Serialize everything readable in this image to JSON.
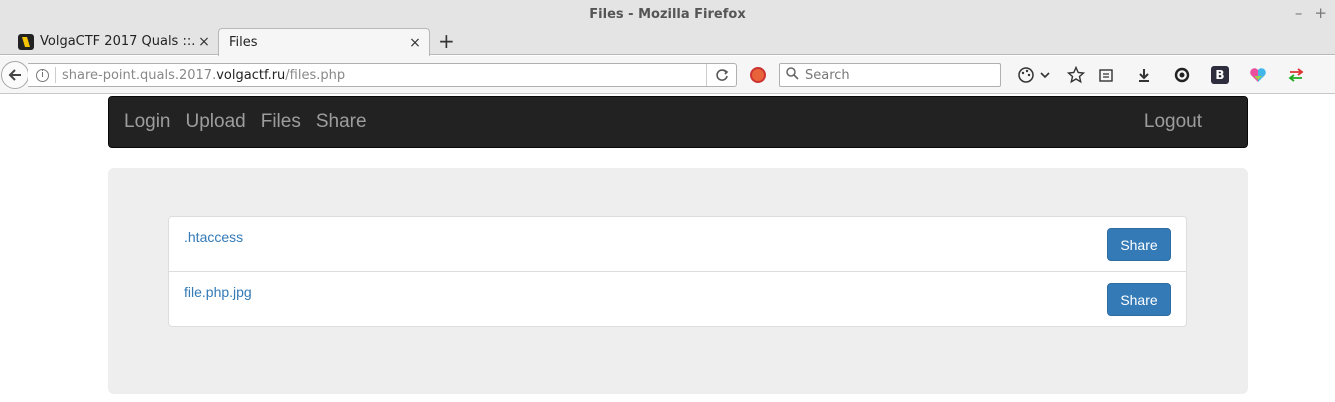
{
  "window": {
    "title": "Files - Mozilla Firefox",
    "minimize": "–",
    "maximize": "+"
  },
  "tabs": [
    {
      "label": "VolgaCTF 2017 Quals ::...",
      "close": "×"
    },
    {
      "label": "Files",
      "close": "×"
    }
  ],
  "new_tab": "+",
  "address": {
    "prefix": "share-point.quals.2017.",
    "domain": "volgactf.ru",
    "path": "/files.php"
  },
  "search": {
    "placeholder": "Search"
  },
  "toolbar_icons": [
    "palette-icon",
    "chevron-down-icon",
    "star-icon",
    "reader-icon",
    "download-icon",
    "sync-icon",
    "bootstrap-icon",
    "colorful-heart-icon",
    "arrows-icon"
  ],
  "site_nav": {
    "links": [
      "Login",
      "Upload",
      "Files",
      "Share"
    ],
    "logout": "Logout"
  },
  "files": [
    {
      "name": ".htaccess",
      "action": "Share"
    },
    {
      "name": "file.php.jpg",
      "action": "Share"
    }
  ],
  "colors": {
    "navbar_bg": "#222222",
    "link": "#337ab7",
    "button": "#337ab7",
    "jumbotron_bg": "#eeeeee"
  }
}
